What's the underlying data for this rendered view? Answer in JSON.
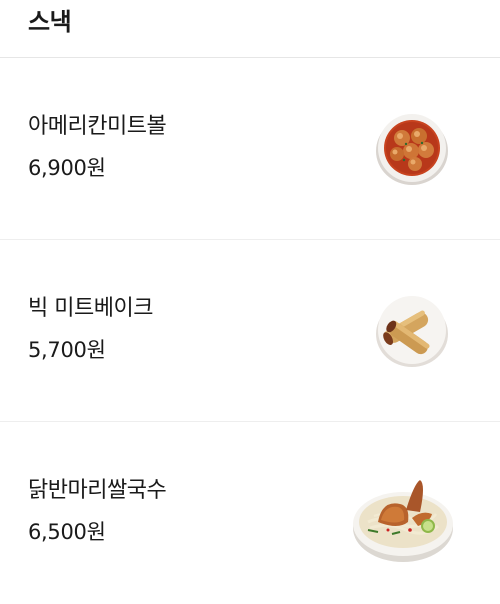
{
  "section": {
    "title": "스낵"
  },
  "items": [
    {
      "name": "아메리칸미트볼",
      "price": "6,900원",
      "image": "meatball-bowl-icon"
    },
    {
      "name": "빅 미트베이크",
      "price": "5,700원",
      "image": "meat-bake-rolls-icon"
    },
    {
      "name": "닭반마리쌀국수",
      "price": "6,500원",
      "image": "chicken-rice-noodle-bowl-icon"
    }
  ],
  "colors": {
    "text": "#1a1a1a",
    "divider": "#eeeeee",
    "background": "#ffffff"
  }
}
